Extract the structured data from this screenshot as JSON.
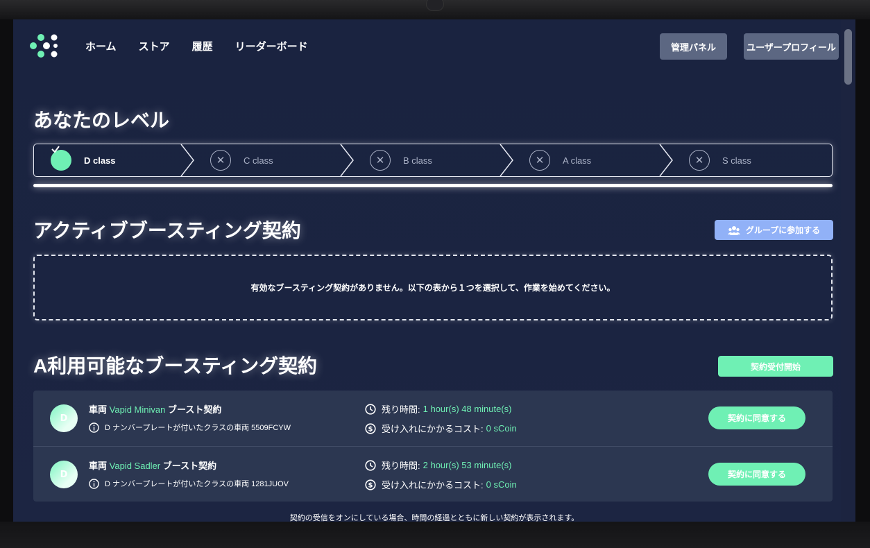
{
  "nav": {
    "items": [
      "ホーム",
      "ストア",
      "履歴",
      "リーダーボード"
    ],
    "admin_label": "管理パネル",
    "profile_label": "ユーザープロフィール"
  },
  "level": {
    "heading": "あなたのレベル",
    "steps": [
      {
        "label": "D class",
        "status": "done"
      },
      {
        "label": "C class",
        "status": "locked"
      },
      {
        "label": "B class",
        "status": "locked"
      },
      {
        "label": "A class",
        "status": "locked"
      },
      {
        "label": "S class",
        "status": "locked"
      }
    ],
    "progress_percent": 100
  },
  "active": {
    "heading": "アクティブブースティング契約",
    "join_group_label": "グループに参加する",
    "empty_message": "有効なブースティング契約がありません。以下の表から１つを選択して、作業を始めてください。"
  },
  "available": {
    "heading": "A利用可能なブースティング契約",
    "start_accepting_label": "契約受付開始",
    "contracts": [
      {
        "badge": "D",
        "title_prefix": "車両",
        "vehicle": "Vapid Minivan",
        "title_suffix": "ブースト契約",
        "plate_text": "D ナンバープレートが付いたクラスの車両 5509FCYW",
        "time_label": "残り時間:",
        "time_value": "1 hour(s) 48 minute(s)",
        "cost_label": "受け入れにかかるコスト:",
        "cost_value": "0 sCoin",
        "agree_label": "契約に同意する"
      },
      {
        "badge": "D",
        "title_prefix": "車両",
        "vehicle": "Vapid Sadler",
        "title_suffix": "ブースト契約",
        "plate_text": "D ナンバープレートが付いたクラスの車両 1281JUOV",
        "time_label": "残り時間:",
        "time_value": "2 hour(s) 53 minute(s)",
        "cost_label": "受け入れにかかるコスト:",
        "cost_value": "0 sCoin",
        "agree_label": "契約に同意する"
      }
    ],
    "footnote": "契約の受信をオンにしている場合、時間の経過とともに新しい契約が表示されます。"
  },
  "colors": {
    "accent_green": "#6ff0b4",
    "accent_blue": "#91b1f7",
    "background": "#1a2340",
    "panel": "#2c3751"
  }
}
